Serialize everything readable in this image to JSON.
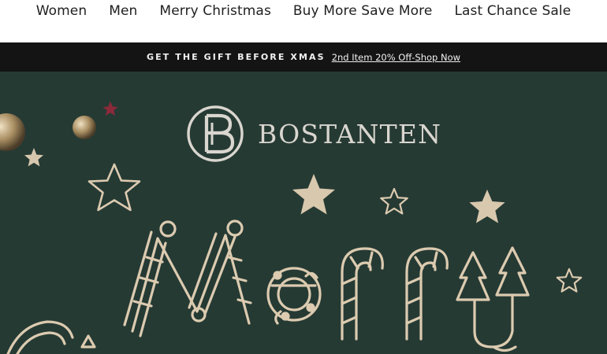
{
  "nav": {
    "items": [
      {
        "label": "Women"
      },
      {
        "label": "Men"
      },
      {
        "label": "Merry Christmas"
      },
      {
        "label": "Buy More Save More"
      },
      {
        "label": "Last Chance Sale"
      }
    ]
  },
  "announcement": {
    "text": "GET THE GIFT BEFORE XMAS",
    "link": "2nd Item 20% Off-Shop Now"
  },
  "hero": {
    "brand": "BOSTANTEN",
    "background_color": "#263a34",
    "doodle_color": "#dccbb0",
    "headline_art": "Merry (hand-drawn candy-cane lettering)"
  }
}
